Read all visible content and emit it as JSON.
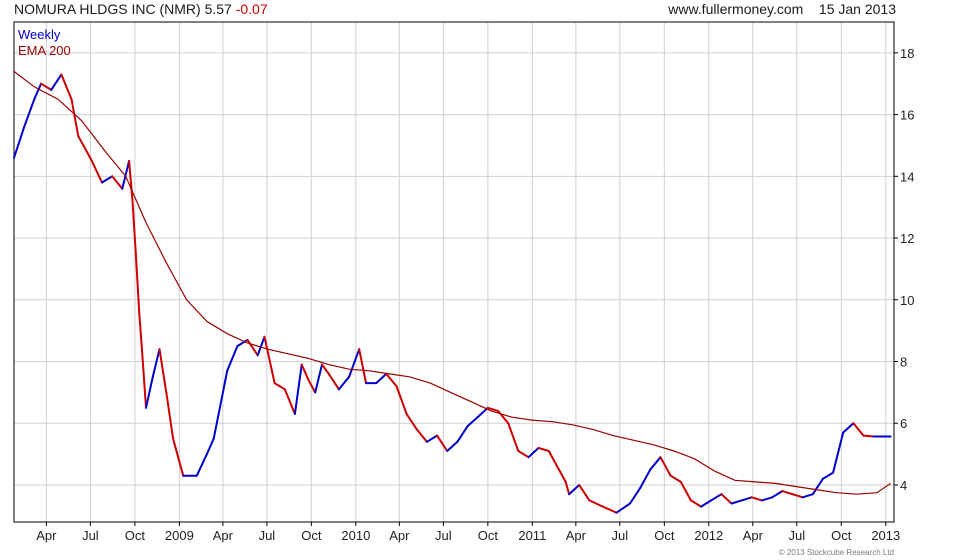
{
  "header": {
    "name": "NOMURA HLDGS INC (NMR)",
    "price": "5.57",
    "change": "-0.07",
    "site": "www.fullermoney.com",
    "date": "15 Jan 2013"
  },
  "legend": {
    "weekly": "Weekly",
    "ema": "EMA 200"
  },
  "footer": "© 2013 Stockcube Research Ltd",
  "colors": {
    "up": "#0000cc",
    "down": "#cc0000",
    "ema": "#990000",
    "grid": "#d0d0d0",
    "frame": "#000000"
  },
  "chart_data": {
    "type": "line",
    "title": "NOMURA HLDGS INC (NMR)",
    "xlabel": "",
    "ylabel": "",
    "xlim": [
      "2008-01-25",
      "2013-01-18"
    ],
    "ylim": [
      2.8,
      19
    ],
    "y_ticks": [
      4,
      6,
      8,
      10,
      12,
      14,
      16,
      18
    ],
    "y_axis_side": "right",
    "grid": true,
    "legend_position": "top-left",
    "x_ticks": [
      {
        "label": "Apr",
        "date": "2008-04-01"
      },
      {
        "label": "Jul",
        "date": "2008-07-01"
      },
      {
        "label": "Oct",
        "date": "2008-10-01"
      },
      {
        "label": "2009",
        "date": "2009-01-01"
      },
      {
        "label": "Apr",
        "date": "2009-04-01"
      },
      {
        "label": "Jul",
        "date": "2009-07-01"
      },
      {
        "label": "Oct",
        "date": "2009-10-01"
      },
      {
        "label": "2010",
        "date": "2010-01-01"
      },
      {
        "label": "Apr",
        "date": "2010-04-01"
      },
      {
        "label": "Jul",
        "date": "2010-07-01"
      },
      {
        "label": "Oct",
        "date": "2010-10-01"
      },
      {
        "label": "2011",
        "date": "2011-01-01"
      },
      {
        "label": "Apr",
        "date": "2011-04-01"
      },
      {
        "label": "Jul",
        "date": "2011-07-01"
      },
      {
        "label": "Oct",
        "date": "2011-10-01"
      },
      {
        "label": "2012",
        "date": "2012-01-01"
      },
      {
        "label": "Apr",
        "date": "2012-04-01"
      },
      {
        "label": "Jul",
        "date": "2012-07-01"
      },
      {
        "label": "Oct",
        "date": "2012-10-01"
      },
      {
        "label": "2013",
        "date": "2013-01-01"
      }
    ],
    "series": [
      {
        "name": "Weekly",
        "style": "close-path",
        "x": [
          "2008-01-25",
          "2008-02-15",
          "2008-03-07",
          "2008-03-21",
          "2008-04-11",
          "2008-05-02",
          "2008-05-23",
          "2008-06-06",
          "2008-06-20",
          "2008-07-04",
          "2008-07-25",
          "2008-08-15",
          "2008-09-05",
          "2008-09-19",
          "2008-09-26",
          "2008-10-03",
          "2008-10-10",
          "2008-10-17",
          "2008-10-24",
          "2008-11-07",
          "2008-11-21",
          "2008-12-05",
          "2008-12-19",
          "2009-01-09",
          "2009-02-06",
          "2009-02-27",
          "2009-03-13",
          "2009-03-27",
          "2009-04-10",
          "2009-05-01",
          "2009-05-22",
          "2009-06-12",
          "2009-06-26",
          "2009-07-17",
          "2009-08-07",
          "2009-08-28",
          "2009-09-11",
          "2009-09-25",
          "2009-10-09",
          "2009-10-23",
          "2009-11-06",
          "2009-11-27",
          "2009-12-18",
          "2010-01-08",
          "2010-01-22",
          "2010-02-12",
          "2010-03-05",
          "2010-03-26",
          "2010-04-16",
          "2010-05-07",
          "2010-05-28",
          "2010-06-18",
          "2010-07-09",
          "2010-07-30",
          "2010-08-20",
          "2010-09-10",
          "2010-10-01",
          "2010-10-22",
          "2010-11-12",
          "2010-12-03",
          "2010-12-24",
          "2011-01-14",
          "2011-02-04",
          "2011-02-25",
          "2011-03-11",
          "2011-03-18",
          "2011-04-08",
          "2011-04-29",
          "2011-05-27",
          "2011-06-24",
          "2011-07-22",
          "2011-08-12",
          "2011-09-02",
          "2011-09-23",
          "2011-10-14",
          "2011-11-04",
          "2011-11-25",
          "2011-12-16",
          "2012-01-06",
          "2012-01-27",
          "2012-02-17",
          "2012-03-09",
          "2012-03-30",
          "2012-04-20",
          "2012-05-11",
          "2012-06-01",
          "2012-06-22",
          "2012-07-13",
          "2012-08-03",
          "2012-08-24",
          "2012-09-14",
          "2012-10-05",
          "2012-10-26",
          "2012-11-16",
          "2012-12-07",
          "2012-12-28",
          "2013-01-04",
          "2013-01-11"
        ],
        "values": [
          14.6,
          15.6,
          16.5,
          17.0,
          16.8,
          17.3,
          16.5,
          15.3,
          14.9,
          14.5,
          13.8,
          14.0,
          13.6,
          14.5,
          13.2,
          11.5,
          9.6,
          8.1,
          6.5,
          7.5,
          8.4,
          7.0,
          5.5,
          4.3,
          4.3,
          5.0,
          5.5,
          6.6,
          7.7,
          8.5,
          8.7,
          8.2,
          8.8,
          7.3,
          7.1,
          6.3,
          7.9,
          7.4,
          7.0,
          7.9,
          7.6,
          7.1,
          7.5,
          8.4,
          7.3,
          7.3,
          7.6,
          7.2,
          6.3,
          5.8,
          5.4,
          5.6,
          5.1,
          5.4,
          5.9,
          6.2,
          6.5,
          6.4,
          6.0,
          5.1,
          4.9,
          5.2,
          5.1,
          4.5,
          4.1,
          3.7,
          4.0,
          3.5,
          3.3,
          3.1,
          3.4,
          3.9,
          4.5,
          4.9,
          4.3,
          4.1,
          3.5,
          3.3,
          3.5,
          3.7,
          3.4,
          3.5,
          3.6,
          3.5,
          3.6,
          3.8,
          3.7,
          3.6,
          3.7,
          4.2,
          4.4,
          5.7,
          6.0,
          5.6,
          5.57,
          5.57,
          5.57,
          5.57
        ]
      },
      {
        "name": "EMA 200",
        "x": [
          "2008-01-25",
          "2008-03-07",
          "2008-04-25",
          "2008-06-13",
          "2008-08-01",
          "2008-09-12",
          "2008-10-24",
          "2008-12-05",
          "2009-01-16",
          "2009-02-27",
          "2009-04-10",
          "2009-05-22",
          "2009-07-03",
          "2009-08-14",
          "2009-09-25",
          "2009-11-06",
          "2009-12-18",
          "2010-01-29",
          "2010-03-12",
          "2010-04-23",
          "2010-06-04",
          "2010-07-16",
          "2010-08-27",
          "2010-10-08",
          "2010-11-19",
          "2010-12-31",
          "2011-02-11",
          "2011-03-25",
          "2011-05-06",
          "2011-06-17",
          "2011-07-29",
          "2011-09-09",
          "2011-10-21",
          "2011-12-02",
          "2012-01-13",
          "2012-02-24",
          "2012-04-06",
          "2012-05-18",
          "2012-06-29",
          "2012-08-10",
          "2012-09-21",
          "2012-11-02",
          "2012-12-14",
          "2013-01-11"
        ],
        "values": [
          17.4,
          16.9,
          16.5,
          15.8,
          14.8,
          14.0,
          12.5,
          11.2,
          10.0,
          9.3,
          8.9,
          8.6,
          8.4,
          8.25,
          8.1,
          7.9,
          7.75,
          7.7,
          7.6,
          7.5,
          7.3,
          7.0,
          6.7,
          6.4,
          6.2,
          6.1,
          6.05,
          5.95,
          5.8,
          5.6,
          5.45,
          5.3,
          5.1,
          4.85,
          4.45,
          4.15,
          4.1,
          4.05,
          3.95,
          3.85,
          3.75,
          3.7,
          3.75,
          4.05
        ]
      }
    ]
  }
}
